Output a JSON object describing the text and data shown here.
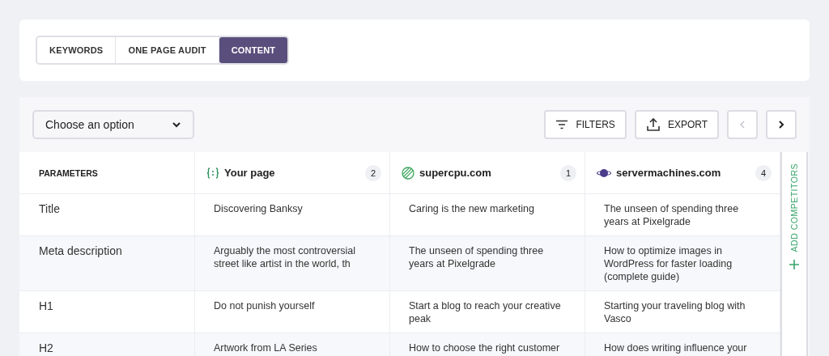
{
  "tabs": [
    {
      "label": "KEYWORDS",
      "selected": false
    },
    {
      "label": "ONE PAGE AUDIT",
      "selected": false
    },
    {
      "label": "CONTENT",
      "selected": true
    }
  ],
  "dropdown": {
    "placeholder": "Choose an option"
  },
  "toolbar": {
    "filters": "FILTERS",
    "export": "EXPORT"
  },
  "table": {
    "parameters_heading": "PARAMETERS",
    "columns": [
      {
        "kind": "own",
        "name": "Your page",
        "count": "2"
      },
      {
        "kind": "globe",
        "name": "supercpu.com",
        "count": "1"
      },
      {
        "kind": "server",
        "name": "servermachines.com",
        "count": "4"
      }
    ],
    "rows": [
      {
        "label": "Title",
        "cells": [
          "Discovering Banksy",
          "Caring is the new marketing",
          "The unseen of spending three years at Pixelgrade"
        ]
      },
      {
        "label": "Meta description",
        "cells": [
          "Arguably the most controversial street like artist in the world, th",
          "The unseen of spending three years at Pixelgrade",
          "How to optimize images in WordPress for faster loading (complete guide)"
        ]
      },
      {
        "label": "H1",
        "cells": [
          "Do not punish yourself",
          "Start a blog to reach your creative peak",
          "Starting your traveling blog with Vasco"
        ]
      },
      {
        "label": "H2",
        "cells": [
          "Artwork from LA Series",
          "How to choose the right customer",
          "How does writing influence your"
        ]
      }
    ]
  },
  "add_competitors": "ADD COMPETITORS"
}
